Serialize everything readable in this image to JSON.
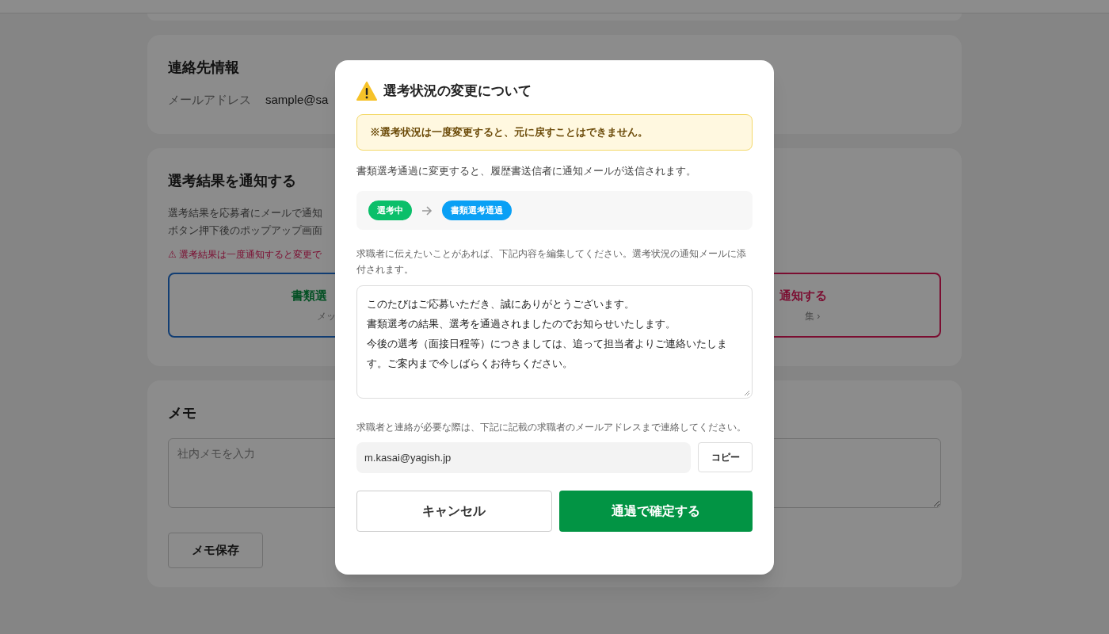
{
  "page": {
    "contact": {
      "title": "連絡先情報",
      "email_label": "メールアドレス",
      "email_value": "sample@sa"
    },
    "notify": {
      "title": "選考結果を通知する",
      "description_lines": [
        "選考結果を応募者にメールで通知",
        "ボタン押下後のポップアップ画面"
      ],
      "warning": "⚠ 選考結果は一度通知すると変更で",
      "options": [
        {
          "kind": "pass",
          "title": "書類選",
          "subtitle": "メッ"
        },
        {
          "kind": "reject",
          "title": "通知する",
          "subtitle": "集 ›"
        }
      ]
    },
    "memo": {
      "title": "メモ",
      "placeholder": "社内メモを入力",
      "save_button": "メモ保存"
    }
  },
  "dialog": {
    "title": "選考状況の変更について",
    "alert": "※選考状況は一度変更すると、元に戻すことはできません。",
    "description": "書類選考通過に変更すると、履歴書送信者に通知メールが送信されます。",
    "status_change": {
      "from": {
        "label": "選考中",
        "color": "#0bbf6a"
      },
      "to": {
        "label": "書類選考通過",
        "color": "#0aa0f5"
      }
    },
    "message_hint": "求職者に伝えたいことがあれば、下記内容を編集してください。選考状況の通知メールに添付されます。",
    "message_lines": [
      "このたびはご応募いただき、誠にありがとうございます。",
      "書類選考の結果、選考を通過されましたのでお知らせいたします。",
      "今後の選考（面接日程等）につきましては、追って担当者よりご連絡いたします。ご案内まで今しばらくお待ちください。"
    ],
    "contact_hint": "求職者と連絡が必要な際は、下記に記載の求職者のメールアドレスまで連絡してください。",
    "email": "m.kasai@yagish.jp",
    "copy_button": "コピー",
    "cancel_button": "キャンセル",
    "confirm_button": "通過で確定する"
  }
}
